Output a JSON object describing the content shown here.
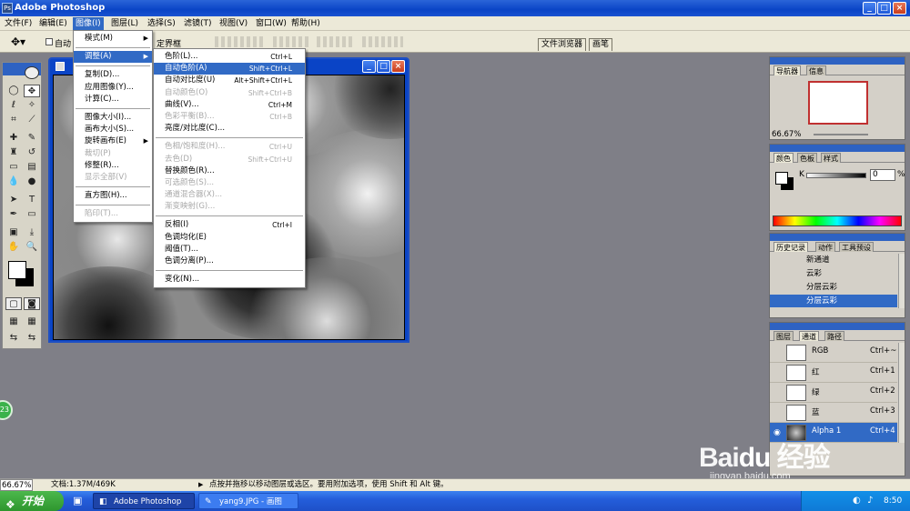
{
  "app": {
    "title": "Adobe Photoshop"
  },
  "window_controls": [
    "_",
    "□",
    "×"
  ],
  "menubar": [
    {
      "label": "文件(F)"
    },
    {
      "label": "编辑(E)"
    },
    {
      "label": "图像(I)",
      "active": true
    },
    {
      "label": "图层(L)"
    },
    {
      "label": "选择(S)"
    },
    {
      "label": "滤镜(T)"
    },
    {
      "label": "视图(V)"
    },
    {
      "label": "窗口(W)"
    },
    {
      "label": "帮助(H)"
    }
  ],
  "options": {
    "auto_label": "自动",
    "bounding_label": "定界框"
  },
  "palette_well": {
    "tabs": [
      "文件浏览器",
      "画笔"
    ]
  },
  "image_menu": {
    "items": [
      {
        "label": "模式(M)",
        "arrow": "▶"
      },
      {
        "sep": true
      },
      {
        "label": "调整(A)",
        "arrow": "▶",
        "highlight": true
      },
      {
        "sep": true
      },
      {
        "label": "复制(D)..."
      },
      {
        "label": "应用图像(Y)..."
      },
      {
        "label": "计算(C)..."
      },
      {
        "sep": true
      },
      {
        "label": "图像大小(I)..."
      },
      {
        "label": "画布大小(S)..."
      },
      {
        "label": "旋转画布(E)",
        "arrow": "▶"
      },
      {
        "label": "裁切(P)",
        "disabled": true
      },
      {
        "label": "修整(R)..."
      },
      {
        "label": "显示全部(V)",
        "disabled": true
      },
      {
        "sep": true
      },
      {
        "label": "直方图(H)..."
      },
      {
        "sep": true
      },
      {
        "label": "陷印(T)...",
        "disabled": true
      }
    ]
  },
  "adjust_menu": {
    "items": [
      {
        "label": "色阶(L)...",
        "shortcut": "Ctrl+L"
      },
      {
        "label": "自动色阶(A)",
        "shortcut": "Shift+Ctrl+L",
        "highlight": true
      },
      {
        "label": "自动对比度(U)",
        "shortcut": "Alt+Shift+Ctrl+L"
      },
      {
        "label": "自动颜色(O)",
        "shortcut": "Shift+Ctrl+B",
        "disabled": true
      },
      {
        "label": "曲线(V)...",
        "shortcut": "Ctrl+M"
      },
      {
        "label": "色彩平衡(B)...",
        "shortcut": "Ctrl+B",
        "disabled": true
      },
      {
        "label": "亮度/对比度(C)..."
      },
      {
        "sep": true
      },
      {
        "label": "色相/饱和度(H)...",
        "shortcut": "Ctrl+U",
        "disabled": true
      },
      {
        "label": "去色(D)",
        "shortcut": "Shift+Ctrl+U",
        "disabled": true
      },
      {
        "label": "替换颜色(R)..."
      },
      {
        "label": "可选颜色(S)...",
        "disabled": true
      },
      {
        "label": "通道混合器(X)...",
        "disabled": true
      },
      {
        "label": "渐变映射(G)...",
        "disabled": true
      },
      {
        "sep": true
      },
      {
        "label": "反相(I)",
        "shortcut": "Ctrl+I"
      },
      {
        "label": "色调均化(E)"
      },
      {
        "label": "阈值(T)..."
      },
      {
        "label": "色调分离(P)..."
      },
      {
        "sep": true
      },
      {
        "label": "变化(N)..."
      }
    ]
  },
  "navigator_panel": {
    "tabs": [
      "导航器",
      "信息"
    ],
    "zoom": "66.67%"
  },
  "color_panel": {
    "tabs": [
      "颜色",
      "色板",
      "样式"
    ],
    "channel": "K",
    "value": "0",
    "unit": "%"
  },
  "history_panel": {
    "tabs": [
      "历史记录",
      "动作",
      "工具预设"
    ],
    "items": [
      {
        "label": "新通道"
      },
      {
        "label": "云彩"
      },
      {
        "label": "分层云彩"
      },
      {
        "label": "分层云彩",
        "selected": true
      }
    ]
  },
  "channels_panel": {
    "tabs": [
      "图层",
      "通道",
      "路径"
    ],
    "channels": [
      {
        "name": "RGB",
        "shortcut": "Ctrl+~"
      },
      {
        "name": "红",
        "shortcut": "Ctrl+1"
      },
      {
        "name": "绿",
        "shortcut": "Ctrl+2"
      },
      {
        "name": "蓝",
        "shortcut": "Ctrl+3"
      },
      {
        "name": "Alpha 1",
        "shortcut": "Ctrl+4",
        "selected": true
      }
    ]
  },
  "statusbar": {
    "zoom": "66.67%",
    "doc_info": "文档:1.37M/469K",
    "hint": "点按并拖移以移动图层或选区。要用附加选项，使用 Shift 和 Alt 键。"
  },
  "taskbar": {
    "start": "开始",
    "tasks": [
      "Adobe Photoshop",
      "yang9.JPG - 画图"
    ],
    "clock": "8:50"
  },
  "badge": {
    "text": "23"
  },
  "colors": {
    "accent": "#316ac5",
    "titlebar": "#0a44c6",
    "workspace": "#7f7f87",
    "taskbar": "#245edb"
  }
}
